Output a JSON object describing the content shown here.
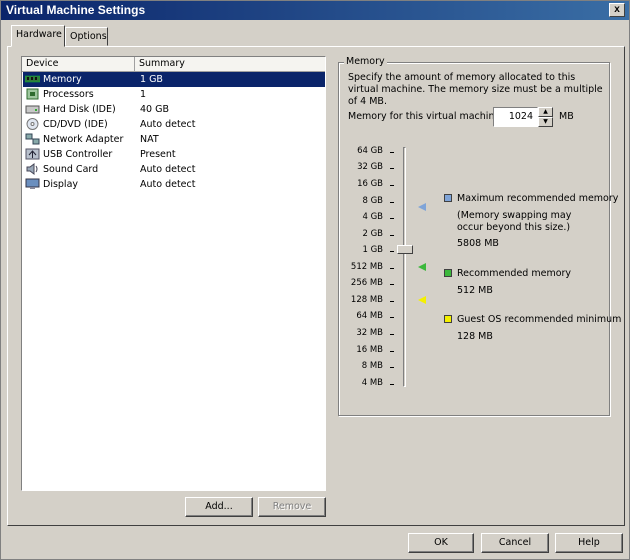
{
  "window": {
    "title": "Virtual Machine Settings",
    "close_symbol": "x"
  },
  "tabs": [
    {
      "label": "Hardware"
    },
    {
      "label": "Options"
    }
  ],
  "device_list": {
    "columns": [
      "Device",
      "Summary"
    ],
    "rows": [
      {
        "icon": "memory-icon",
        "device": "Memory",
        "summary": "1 GB",
        "selected": true
      },
      {
        "icon": "processor-icon",
        "device": "Processors",
        "summary": "1"
      },
      {
        "icon": "hard-disk-icon",
        "device": "Hard Disk (IDE)",
        "summary": "40 GB"
      },
      {
        "icon": "cd-dvd-icon",
        "device": "CD/DVD (IDE)",
        "summary": "Auto detect"
      },
      {
        "icon": "network-adapter-icon",
        "device": "Network Adapter",
        "summary": "NAT"
      },
      {
        "icon": "usb-controller-icon",
        "device": "USB Controller",
        "summary": "Present"
      },
      {
        "icon": "sound-card-icon",
        "device": "Sound Card",
        "summary": "Auto detect"
      },
      {
        "icon": "display-icon",
        "device": "Display",
        "summary": "Auto detect"
      }
    ],
    "add_label": "Add...",
    "remove_label": "Remove"
  },
  "memory": {
    "group_title": "Memory",
    "description": "Specify the amount of memory allocated to this virtual machine. The memory size must be a multiple of 4 MB.",
    "field_label": "Memory for this virtual machine:",
    "value": "1024",
    "unit": "MB",
    "scale": [
      "64 GB",
      "32 GB",
      "16 GB",
      "8 GB",
      "4 GB",
      "2 GB",
      "1 GB",
      "512 MB",
      "256 MB",
      "128 MB",
      "64 MB",
      "32 MB",
      "16 MB",
      "8 MB",
      "4 MB"
    ],
    "legend": {
      "max": {
        "title": "Maximum recommended memory",
        "note": "(Memory swapping may occur beyond this size.)",
        "value": "5808 MB",
        "color": "#7fa4d8"
      },
      "rec": {
        "title": "Recommended memory",
        "value": "512 MB",
        "color": "#3cb83c"
      },
      "min": {
        "title": "Guest OS recommended minimum",
        "value": "128 MB",
        "color": "#f4f000"
      }
    }
  },
  "footer": {
    "ok_label": "OK",
    "cancel_label": "Cancel",
    "help_label": "Help"
  }
}
